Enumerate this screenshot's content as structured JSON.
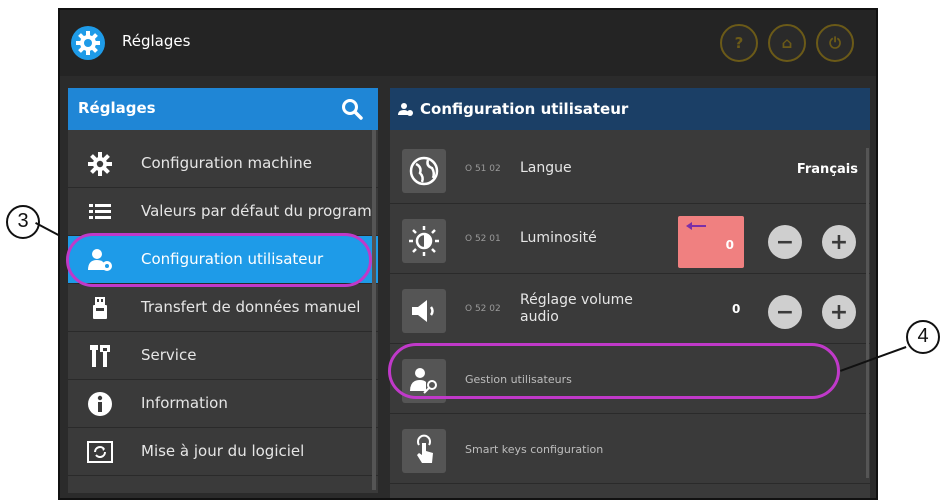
{
  "app": {
    "title": "Réglages"
  },
  "topbar": {
    "buttons": [
      {
        "glyph": "?"
      },
      {
        "glyph": "⌂"
      },
      {
        "glyph": "⏻"
      }
    ]
  },
  "left_panel": {
    "header": "Réglages",
    "items": [
      {
        "label": "Configuration machine",
        "icon": "gear-icon",
        "active": false
      },
      {
        "label": "Valeurs par défaut du program",
        "icon": "list-icon",
        "active": false
      },
      {
        "label": "Configuration utilisateur",
        "icon": "user-settings-icon",
        "active": true
      },
      {
        "label": "Transfert de données manuel",
        "icon": "usb-icon",
        "active": false
      },
      {
        "label": "Service",
        "icon": "tools-icon",
        "active": false
      },
      {
        "label": "Information",
        "icon": "info-icon",
        "active": false
      },
      {
        "label": "Mise à jour du logiciel",
        "icon": "refresh-icon",
        "active": false
      }
    ]
  },
  "right_panel": {
    "header": "Configuration utilisateur",
    "rows": [
      {
        "code": "O 51 02",
        "label": "Langue",
        "value": "Français",
        "icon": "globe-icon"
      },
      {
        "code": "O 52 01",
        "label": "Luminosité",
        "value": "0",
        "icon": "brightness-icon"
      },
      {
        "code": "O 52 02",
        "label": "Réglage volume audio",
        "value": "0",
        "icon": "speaker-icon"
      },
      {
        "label": "Gestion utilisateurs",
        "icon": "user-key-icon"
      },
      {
        "label": "Smart keys configuration",
        "icon": "touch-icon"
      }
    ],
    "stepper": {
      "minus": "−",
      "plus": "+"
    }
  },
  "callouts": [
    {
      "number": "3"
    },
    {
      "number": "4"
    }
  ],
  "colors": {
    "accent": "#1e9be8",
    "header_dark": "#1b3f66",
    "callout": "#c039c9",
    "highlight": "#f08080"
  }
}
